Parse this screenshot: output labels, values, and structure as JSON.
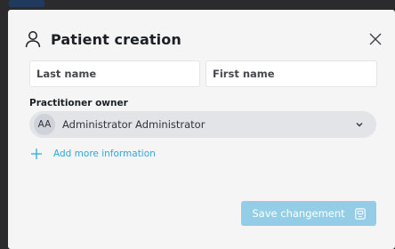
{
  "modal": {
    "title": "Patient creation",
    "icons": {
      "header": "user-icon",
      "close": "close-icon"
    }
  },
  "form": {
    "last_name": {
      "placeholder": "Last name",
      "value": ""
    },
    "first_name": {
      "placeholder": "First name",
      "value": ""
    },
    "practitioner": {
      "label": "Practitioner owner",
      "avatar_initials": "AA",
      "selected": "Administrator Administrator",
      "icon": "chevron-down-icon"
    },
    "add_more": {
      "label": "Add more information",
      "icon": "plus-icon"
    }
  },
  "footer": {
    "save_label": "Save changement",
    "save_icon": "save-icon"
  },
  "colors": {
    "accent": "#2fa8d8",
    "save_button": "#93cde6",
    "select_bg": "#e2e4e8",
    "modal_bg": "#f5f5f6"
  }
}
